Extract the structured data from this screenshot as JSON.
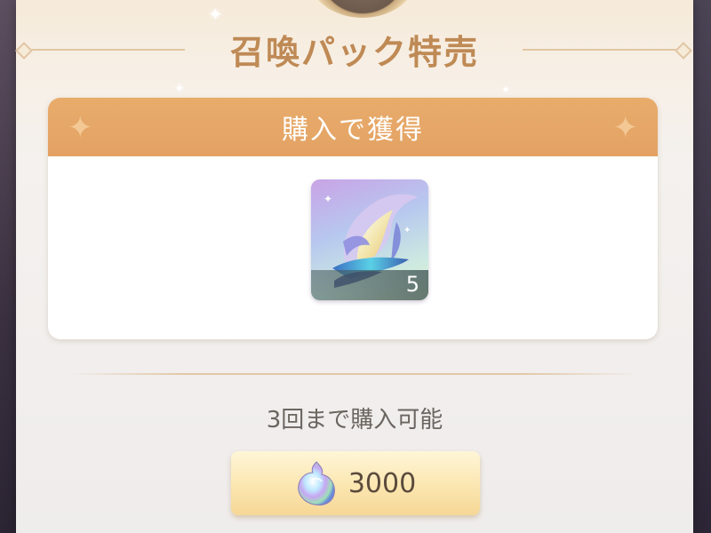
{
  "title": "召喚パック特売",
  "reward_header": "購入で獲得",
  "reward_item": {
    "name_icon": "feather-item-icon",
    "count": "5"
  },
  "purchase_limit": "3回まで購入可能",
  "price_button": {
    "currency_icon": "gem-icon",
    "price": "3000"
  },
  "colors": {
    "title": "#bf8a55",
    "header": "#e3a264",
    "button": "#f6d796"
  }
}
